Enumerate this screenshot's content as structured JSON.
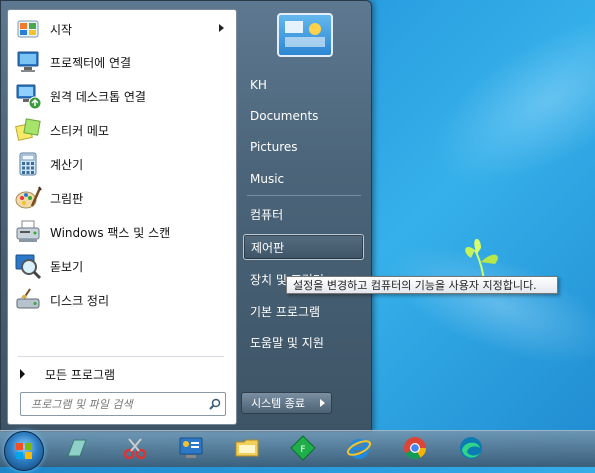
{
  "start_menu": {
    "programs": [
      {
        "label": "시작",
        "icon": "getting-started-icon",
        "has_submenu": true
      },
      {
        "label": "프로젝터에 연결",
        "icon": "projector-icon",
        "has_submenu": false
      },
      {
        "label": "원격 데스크톱 연결",
        "icon": "remote-desktop-icon",
        "has_submenu": false
      },
      {
        "label": "스티커 메모",
        "icon": "sticky-notes-icon",
        "has_submenu": false
      },
      {
        "label": "계산기",
        "icon": "calculator-icon",
        "has_submenu": false
      },
      {
        "label": "그림판",
        "icon": "paint-icon",
        "has_submenu": false
      },
      {
        "label": "Windows 팩스 및 스캔",
        "icon": "fax-scan-icon",
        "has_submenu": false
      },
      {
        "label": "돋보기",
        "icon": "magnifier-icon",
        "has_submenu": false
      },
      {
        "label": "디스크 정리",
        "icon": "disk-cleanup-icon",
        "has_submenu": false
      }
    ],
    "all_programs": "모든 프로그램",
    "search": {
      "placeholder": "프로그램 및 파일 검색",
      "value": ""
    },
    "right_items": [
      {
        "label": "KH"
      },
      {
        "label": "Documents"
      },
      {
        "label": "Pictures"
      },
      {
        "label": "Music"
      },
      {
        "label": "컴퓨터"
      },
      {
        "label": "제어판"
      },
      {
        "label": "장치 및 프린터"
      },
      {
        "label": "기본 프로그램"
      },
      {
        "label": "도움말 및 지원"
      }
    ],
    "shutdown_label": "시스템 종료",
    "tooltip": "설정을 변경하고 컴퓨터의 기능을 사용자 지정합니다."
  },
  "taskbar": {
    "icons": [
      "start-orb-icon",
      "aero-icon",
      "snipping-tool-icon",
      "control-panel-icon",
      "file-explorer-icon",
      "f-app-icon",
      "internet-explorer-icon",
      "chrome-icon",
      "edge-icon"
    ]
  },
  "colors": {
    "desktop": "#2a9ee0",
    "menu_dark": "#4b6479",
    "highlight_border": "#b9c7d3"
  }
}
